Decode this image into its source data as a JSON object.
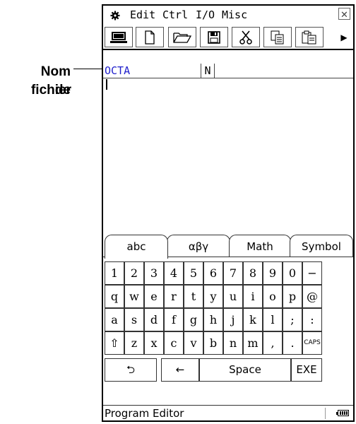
{
  "callout": {
    "line1": "Nom de",
    "line2": "fichier"
  },
  "menu": {
    "gear_icon": "gear-icon",
    "items": [
      "Edit",
      "Ctrl",
      "I/O",
      "Misc"
    ],
    "close": "✕"
  },
  "toolbar": {
    "icons": [
      "screen-icon",
      "new-file-icon",
      "open-folder-icon",
      "save-icon",
      "cut-icon",
      "copy-icon",
      "paste-icon"
    ],
    "more": "▶"
  },
  "file": {
    "name": "OCTA",
    "type": "N"
  },
  "keyboard": {
    "tabs": [
      "abc",
      "αβγ",
      "Math",
      "Symbol"
    ],
    "rows": [
      [
        "1",
        "2",
        "3",
        "4",
        "5",
        "6",
        "7",
        "8",
        "9",
        "0",
        "−"
      ],
      [
        "q",
        "w",
        "e",
        "r",
        "t",
        "y",
        "u",
        "i",
        "o",
        "p",
        "@"
      ],
      [
        "a",
        "s",
        "d",
        "f",
        "g",
        "h",
        "j",
        "k",
        "l",
        ";",
        ":"
      ],
      [
        "⇧",
        "z",
        "x",
        "c",
        "v",
        "b",
        "n",
        "m",
        ",",
        ".",
        "CAPS"
      ]
    ],
    "bottom": {
      "back": "⮌",
      "backspace": "←",
      "space": "Space",
      "exe": "EXE"
    }
  },
  "status": {
    "text": "Program Editor"
  }
}
